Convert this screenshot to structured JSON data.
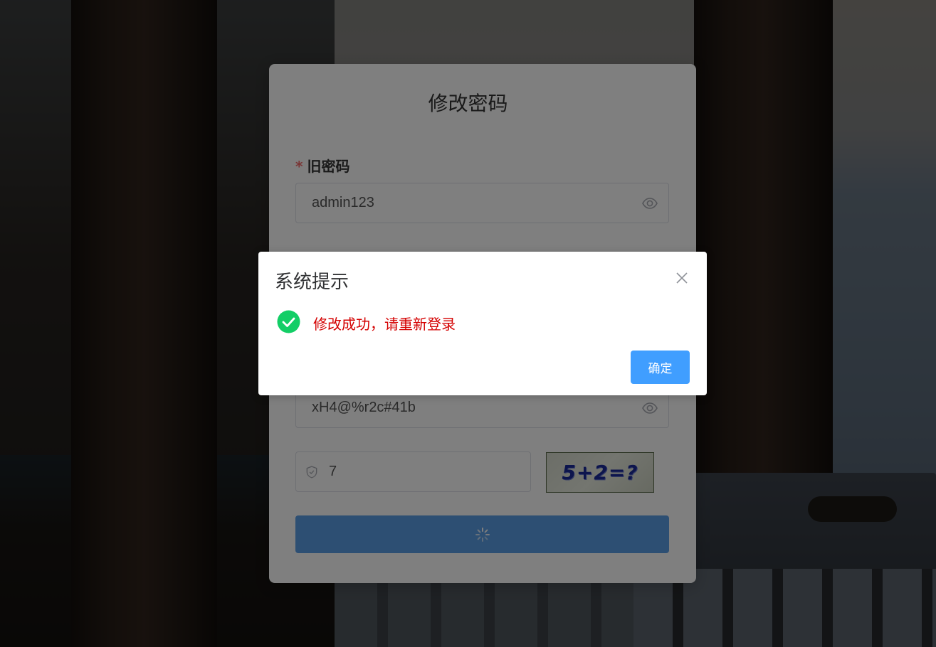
{
  "page": {
    "title": "修改密码"
  },
  "form": {
    "old_password_label": "旧密码",
    "required_mark": "*",
    "old_password_value": "admin123",
    "confirm_password_value": "xH4@%r2c#41b",
    "captcha_value": "7",
    "captcha_image_text": "5+2=?",
    "submit_state": "loading"
  },
  "dialog": {
    "title": "系统提示",
    "message": "修改成功，请重新登录",
    "confirm_label": "确定",
    "status": "success"
  },
  "colors": {
    "primary": "#409eff",
    "success": "#13ce66",
    "message_text": "#d40000",
    "required": "#f56c6c"
  },
  "icons": {
    "eye": "eye-icon",
    "shield": "shield-icon",
    "close": "close-icon",
    "success": "check-circle-icon",
    "loading": "spinner-icon"
  }
}
